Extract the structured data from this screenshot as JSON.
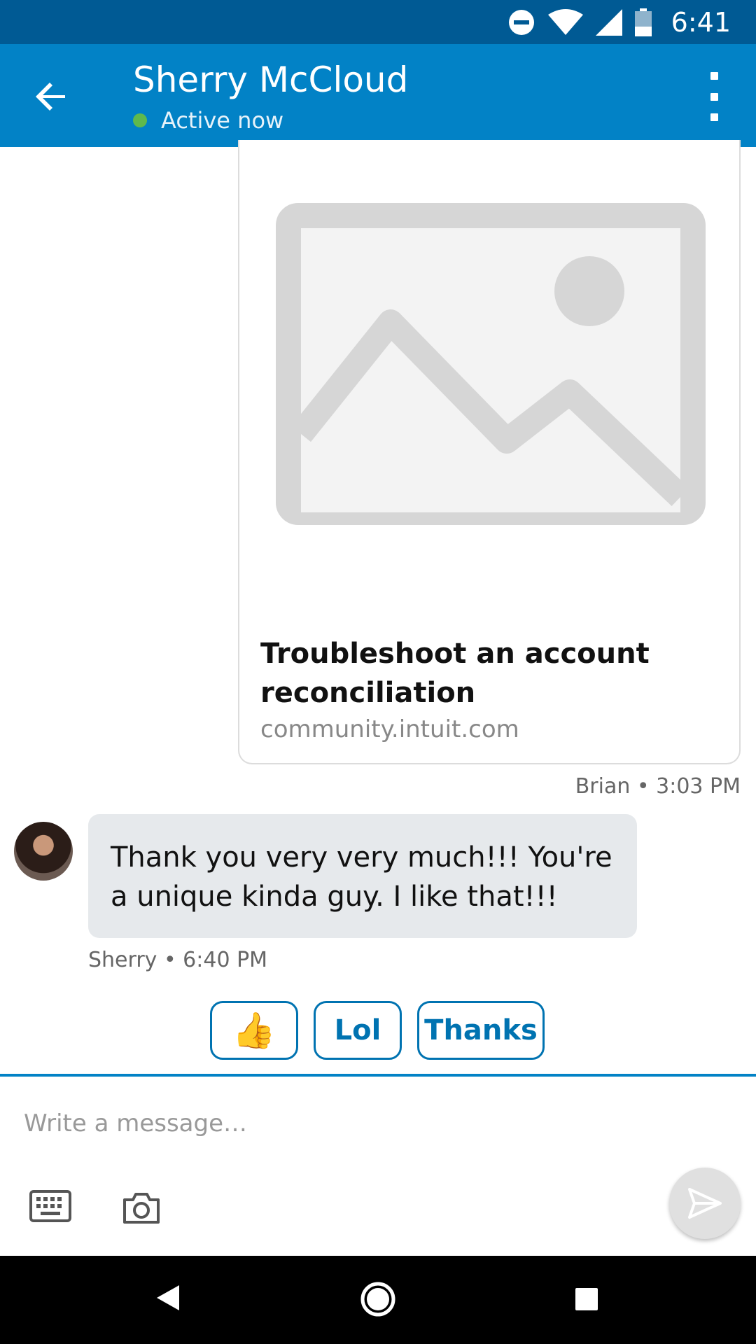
{
  "status_bar": {
    "time": "6:41",
    "icons": [
      "do-not-disturb-icon",
      "wifi-icon",
      "signal-icon",
      "battery-icon"
    ]
  },
  "app_bar": {
    "contact_name": "Sherry McCloud",
    "presence": "Active now",
    "presence_color": "#5fb94d",
    "brand_color": "#0282c6"
  },
  "link_card": {
    "title": "Troubleshoot an account reconciliation",
    "domain": "community.intuit.com"
  },
  "messages": {
    "outgoing_meta": "Brian • 3:03 PM",
    "incoming_text": "Thank you very very much!!! You're a unique kinda guy. I like that!!!",
    "incoming_meta": "Sherry • 6:40 PM"
  },
  "quick_replies": {
    "thumb": "👍",
    "lol": "Lol",
    "thanks": "Thanks"
  },
  "composer": {
    "placeholder": "Write a message…"
  }
}
